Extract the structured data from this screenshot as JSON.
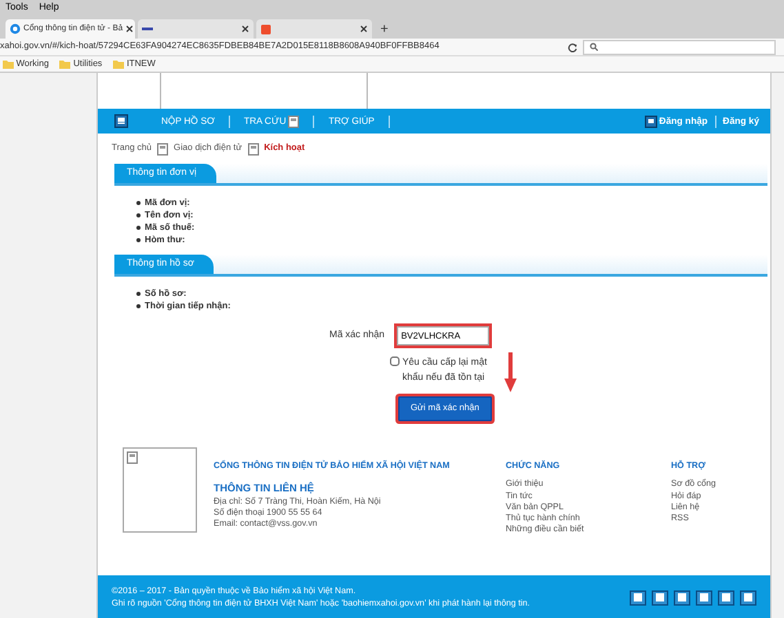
{
  "browser": {
    "menu": [
      "Tools",
      "Help"
    ],
    "tabs": [
      {
        "title": "Cổng thông tin điện tử - Bả",
        "selected": true
      },
      {
        "selected": false
      },
      {
        "selected": false
      }
    ],
    "new_tab": "+",
    "url": "xahoi.gov.vn/#/kich-hoat/57294CE63FA904274EC8635FDBEB84BE7A2D015E8118B8608A940BF0FFBB8464",
    "bookmarks": [
      "Working",
      "Utilities",
      "ITNEW"
    ]
  },
  "nav": {
    "items": [
      "NỘP HỒ SƠ",
      "TRA CỨU",
      "TRỢ GIÚP"
    ],
    "login": "Đăng nhập",
    "register": "Đăng ký"
  },
  "breadcrumb": [
    {
      "label": "Trang chủ",
      "selected": false
    },
    {
      "label": "Giao dịch điện tử",
      "selected": false
    },
    {
      "label": "Kích hoạt",
      "selected": true
    }
  ],
  "sections": [
    {
      "title": "Thông tin đơn vị",
      "fields": [
        "Mã đơn vị:",
        "Tên đơn vị:",
        "Mã số thuế:",
        "Hòm thư:"
      ]
    },
    {
      "title": "Thông tin hồ sơ",
      "fields": [
        "Số hồ sơ:",
        "Thời gian tiếp nhận:"
      ]
    }
  ],
  "form": {
    "label": "Mã xác nhận",
    "value": "BV2VLHCKRA",
    "highlighted": true,
    "checkbox": {
      "label": "Yêu cầu cấp lại mật khẩu nếu đã tồn tại",
      "checked": false
    },
    "button": {
      "label": "Gửi mã xác nhận",
      "highlighted": true
    }
  },
  "footer": {
    "title": "CỔNG THÔNG TIN ĐIỆN TỬ BẢO HIỂM XÃ HỘI VIỆT NAM",
    "contact_title": "THÔNG TIN LIÊN HỆ",
    "contact": [
      "Địa chỉ: Số 7 Tràng Thi, Hoàn Kiếm, Hà Nội",
      "Số điện thoại 1900 55 55 64",
      "Email: contact@vss.gov.vn"
    ],
    "columns": [
      {
        "title": "CHỨC NĂNG",
        "links": [
          "Giới thiệu",
          "Tin tức",
          "Văn bản QPPL",
          "Thủ tục hành chính",
          "Những điều cần biết"
        ]
      },
      {
        "title": "HỖ TRỢ",
        "links": [
          "Sơ đồ cổng",
          "Hỏi đáp",
          "Liên hệ",
          "RSS"
        ]
      }
    ]
  },
  "bottom": {
    "lines": [
      "©2016 – 2017 - Bản quyền thuộc về Bảo hiểm xã hội Việt Nam.",
      "Ghi rõ nguồn 'Cổng thông tin điện tử BHXH Việt Nam' hoặc 'baohiemxahoi.gov.vn' khi phát hành lại thông tin."
    ]
  }
}
